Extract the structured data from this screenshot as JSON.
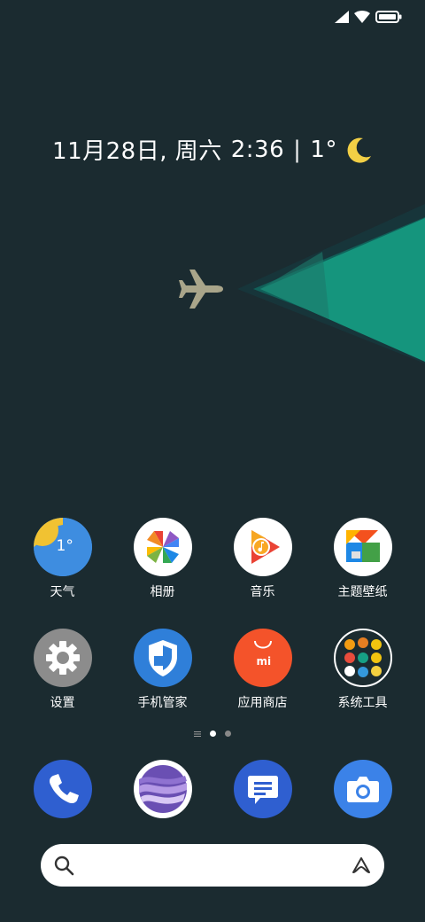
{
  "status_bar": {
    "icons": [
      "signal-icon",
      "wifi-icon",
      "battery-icon"
    ]
  },
  "clock_widget": {
    "date": "11月28日, 周六",
    "time": "2:36",
    "separator": "|",
    "temperature": "1°",
    "weather_icon": "moon-icon"
  },
  "apps_row1": [
    {
      "label": "天气",
      "icon": "weather-icon",
      "icon_text": "1°"
    },
    {
      "label": "相册",
      "icon": "photos-icon"
    },
    {
      "label": "音乐",
      "icon": "music-icon"
    },
    {
      "label": "主题壁纸",
      "icon": "themes-icon"
    }
  ],
  "apps_row2": [
    {
      "label": "设置",
      "icon": "settings-icon"
    },
    {
      "label": "手机管家",
      "icon": "security-icon"
    },
    {
      "label": "应用商店",
      "icon": "app-store-icon",
      "icon_text": "mi"
    },
    {
      "label": "系统工具",
      "icon": "system-tools-folder-icon"
    }
  ],
  "page_indicator": {
    "pages": 2,
    "current": 1
  },
  "dock": [
    {
      "name": "phone",
      "icon": "phone-icon"
    },
    {
      "name": "browser",
      "icon": "browser-icon"
    },
    {
      "name": "messages",
      "icon": "messages-icon"
    },
    {
      "name": "camera",
      "icon": "camera-icon"
    }
  ],
  "search_bar": {
    "placeholder": ""
  },
  "colors": {
    "background": "#1b2b30",
    "teal": "#15957d",
    "moon": "#f2cf45",
    "plane": "#a9a58a"
  }
}
